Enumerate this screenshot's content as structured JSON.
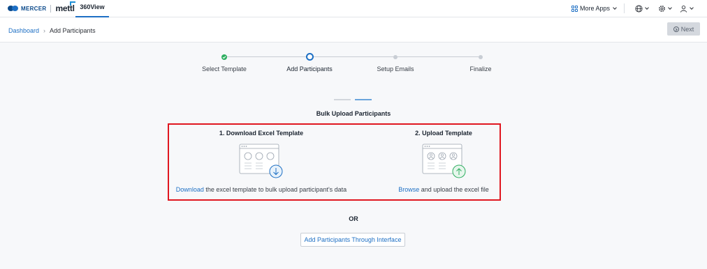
{
  "header": {
    "brand_mercer": "MERCER",
    "brand_mettl": "mettl",
    "app_tab": "360View",
    "more_apps_label": "More Apps",
    "icons": [
      "grid-icon",
      "globe-icon",
      "gear-icon",
      "user-icon"
    ]
  },
  "breadcrumb": {
    "home": "Dashboard",
    "current": "Add Participants"
  },
  "toolbar": {
    "next_label": "Next"
  },
  "stepper": {
    "steps": [
      {
        "label": "Select Template",
        "status": "completed"
      },
      {
        "label": "Add Participants",
        "status": "active"
      },
      {
        "label": "Setup Emails",
        "status": "pending"
      },
      {
        "label": "Finalize",
        "status": "pending"
      }
    ]
  },
  "bulk_upload": {
    "title": "Bulk Upload Participants",
    "download_card": {
      "title": "1. Download Excel Template",
      "link_text": "Download",
      "description": " the excel template to bulk upload participant's data"
    },
    "upload_card": {
      "title": "2. Upload Template",
      "link_text": "Browse",
      "description": " and upload the excel file"
    }
  },
  "or_label": "OR",
  "interface_button_label": "Add Participants Through Interface",
  "colors": {
    "accent": "#1d6fc4",
    "success": "#2eae60",
    "highlight_border": "#e0161f",
    "disabled_button": "#d4d8de"
  }
}
